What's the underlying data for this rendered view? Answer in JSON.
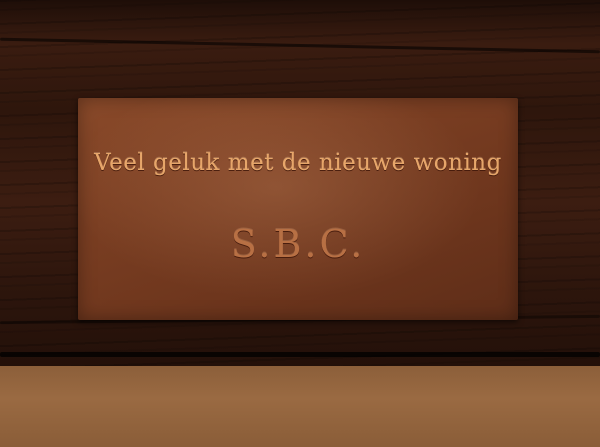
{
  "plaque": {
    "line1": "Veel geluk met de nieuwe woning",
    "line2": "S.B.C."
  },
  "colors": {
    "wood": "#2e160c",
    "brass": "#7a3e22",
    "engraving": "#e7a66a",
    "wall": "#9a6a42"
  }
}
